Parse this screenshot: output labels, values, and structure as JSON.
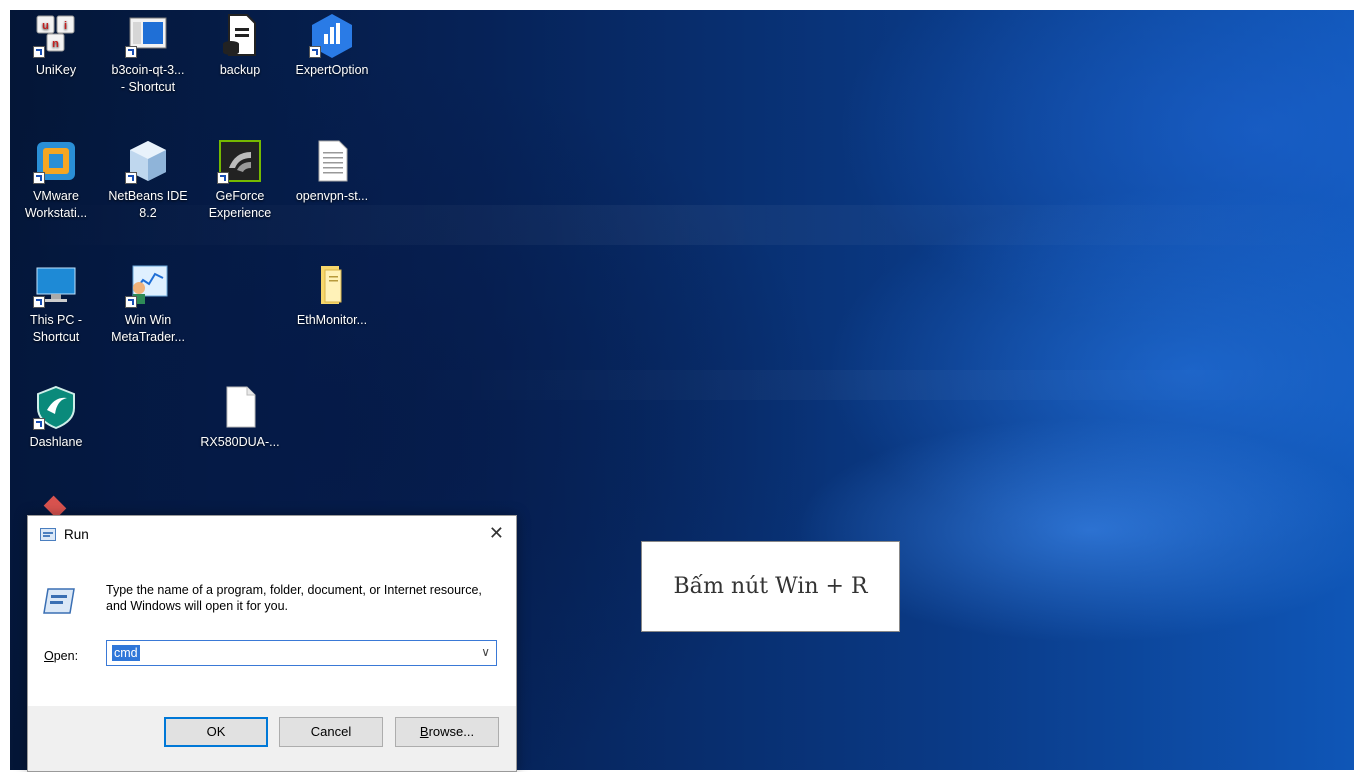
{
  "desktop_icons": [
    {
      "label": "UniKey",
      "icon": "unikey-icon"
    },
    {
      "label": "b3coin-qt-3...\n- Shortcut",
      "icon": "b3coin-icon"
    },
    {
      "label": "backup",
      "icon": "backup-file-icon"
    },
    {
      "label": "ExpertOption",
      "icon": "expertoption-icon"
    },
    {
      "label": "VMware\nWorkstati...",
      "icon": "vmware-icon"
    },
    {
      "label": "NetBeans IDE\n8.2",
      "icon": "netbeans-icon"
    },
    {
      "label": "GeForce\nExperience",
      "icon": "geforce-icon"
    },
    {
      "label": "openvpn-st...",
      "icon": "text-file-icon"
    },
    {
      "label": "This PC -\nShortcut",
      "icon": "this-pc-icon"
    },
    {
      "label": "Win Win\nMetaTrader...",
      "icon": "metatrader-icon"
    },
    {
      "label": "EthMonitor...",
      "icon": "folder-icon"
    },
    {
      "label": "Dashlane",
      "icon": "dashlane-icon"
    },
    {
      "label": "RX580DUA-...",
      "icon": "blank-file-icon"
    }
  ],
  "run_dialog": {
    "title": "Run",
    "description": "Type the name of a program, folder, document, or Internet resource, and Windows will open it for you.",
    "open_label": "Open:",
    "input_value": "cmd",
    "ok_label": "OK",
    "cancel_label": "Cancel",
    "browse_label": "Browse...",
    "close_glyph": "✕"
  },
  "annotation": {
    "text": "Bấm nút Win + R"
  }
}
